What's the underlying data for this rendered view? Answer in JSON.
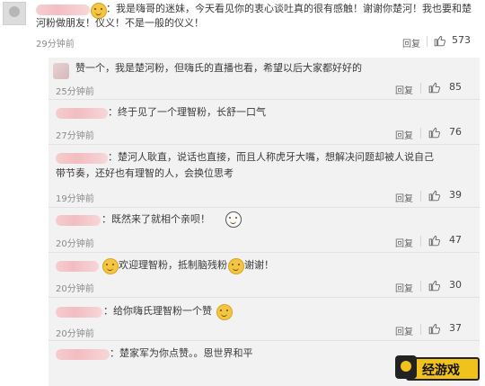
{
  "comments": [
    {
      "text_lines": [
        "：我是嗨哥的迷妹，今天看见你的衷心谈吐真的很有感触！谢谢你楚河！我也要和楚",
        "河粉做朋友！仪义！不是一般的仪义！"
      ],
      "time": "29分钟前",
      "reply": "回复",
      "likes": "573"
    },
    {
      "text_lines": [
        "赞一个，我是楚河粉，但嗨氏的直播也看，希望以后大家都好好的"
      ],
      "time": "25分钟前",
      "reply": "回复",
      "likes": "85"
    },
    {
      "text_lines": [
        "：终于见了一个理智粉，长舒一口气"
      ],
      "time": "27分钟前",
      "reply": "回复",
      "likes": "76"
    },
    {
      "text_lines": [
        "：楚河人耿直，说话也直接，而且人称虎牙大嘴，想解决问题却被人说自己",
        "带节奏，还好也有理智的人，会换位思考"
      ],
      "time": "19分钟前",
      "reply": "回复",
      "likes": "39"
    },
    {
      "text_lines": [
        "：既然来了就相个亲呗！"
      ],
      "time": "20分钟前",
      "reply": "回复",
      "likes": "47"
    },
    {
      "text_lines": [
        "欢迎理智粉，抵制脑残粉",
        "谢谢！"
      ],
      "time": "20分钟前",
      "reply": "回复",
      "likes": "30"
    },
    {
      "text_lines": [
        "：给你嗨氏理智粉一个赞"
      ],
      "time": "20分钟前",
      "reply": "回复",
      "likes": "37"
    },
    {
      "text_lines": [
        "：楚家军为你点赞。。恩世界和平"
      ],
      "time": "",
      "reply": "",
      "likes": ""
    }
  ],
  "watermark": {
    "label": "经游戏"
  }
}
